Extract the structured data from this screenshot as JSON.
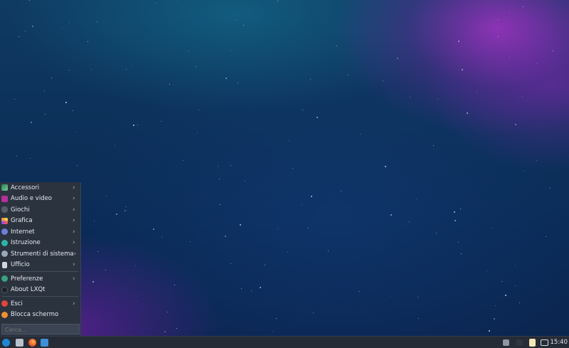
{
  "menu": {
    "items": [
      {
        "label": "Accessori",
        "icon": "accessories-icon",
        "submenu": true
      },
      {
        "label": "Audio e video",
        "icon": "multimedia-icon",
        "submenu": true
      },
      {
        "label": "Giochi",
        "icon": "games-icon",
        "submenu": true
      },
      {
        "label": "Grafica",
        "icon": "graphics-icon",
        "submenu": true
      },
      {
        "label": "Internet",
        "icon": "internet-icon",
        "submenu": true
      },
      {
        "label": "Istruzione",
        "icon": "education-icon",
        "submenu": true
      },
      {
        "label": "Strumenti di sistema",
        "icon": "system-tools-icon",
        "submenu": true
      },
      {
        "label": "Ufficio",
        "icon": "office-icon",
        "submenu": true
      }
    ],
    "settings": [
      {
        "label": "Preferenze",
        "icon": "preferences-icon",
        "submenu": true
      },
      {
        "label": "About LXQt",
        "icon": "about-icon",
        "submenu": false
      }
    ],
    "session": [
      {
        "label": "Esci",
        "icon": "logout-icon",
        "submenu": true
      },
      {
        "label": "Blocca schermo",
        "icon": "lock-screen-icon",
        "submenu": false
      }
    ],
    "search_placeholder": "Cerca...",
    "submenu_arrow": "›"
  },
  "taskbar": {
    "clock": "15:40"
  },
  "colors": {
    "menu_bg": "#2b333f",
    "taskbar_bg": "#262c36",
    "accent": "#3daee9"
  }
}
